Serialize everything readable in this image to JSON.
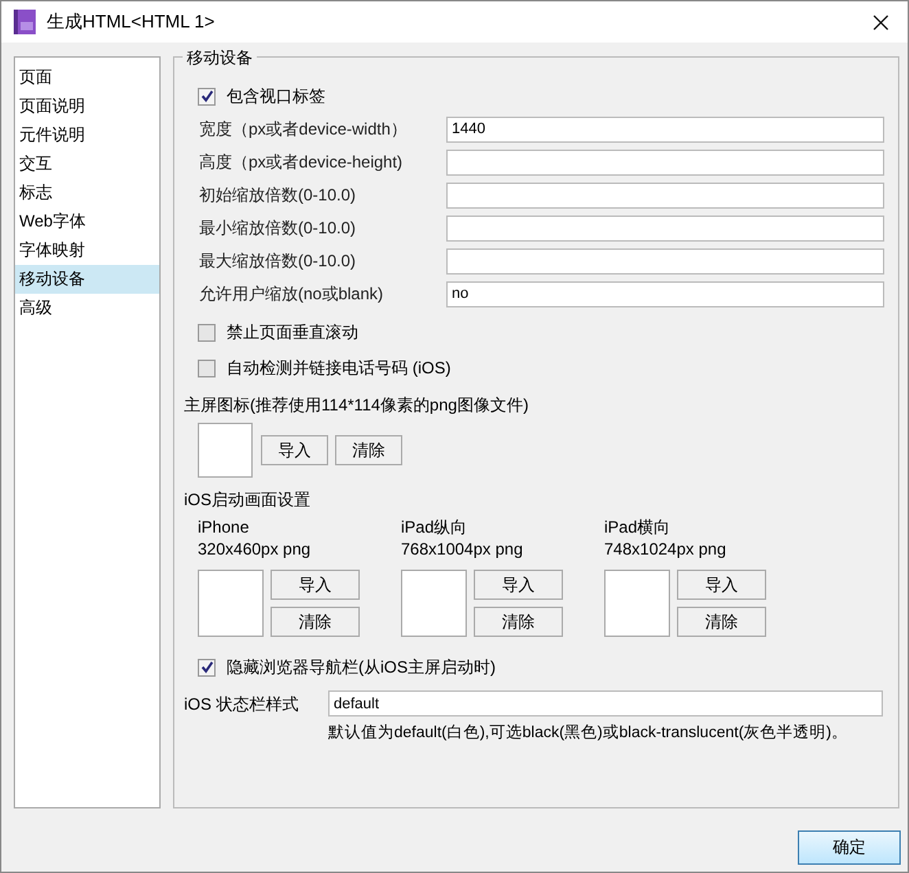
{
  "window": {
    "title": "生成HTML<HTML 1>"
  },
  "sidebar": {
    "items": [
      {
        "label": "页面",
        "selected": false
      },
      {
        "label": "页面说明",
        "selected": false
      },
      {
        "label": "元件说明",
        "selected": false
      },
      {
        "label": "交互",
        "selected": false
      },
      {
        "label": "标志",
        "selected": false
      },
      {
        "label": "Web字体",
        "selected": false
      },
      {
        "label": "字体映射",
        "selected": false
      },
      {
        "label": "移动设备",
        "selected": true
      },
      {
        "label": "高级",
        "selected": false
      }
    ]
  },
  "section": {
    "title": "移动设备",
    "viewport": {
      "label": "包含视口标签",
      "checked": true
    },
    "fields": [
      {
        "label": "宽度（px或者device-width）",
        "value": "1440"
      },
      {
        "label": "高度（px或者device-height)"
      },
      {
        "label": "初始缩放倍数(0-10.0)"
      },
      {
        "label": "最小缩放倍数(0-10.0)"
      },
      {
        "label": "最大缩放倍数(0-10.0)"
      },
      {
        "label": "允许用户缩放(no或blank)",
        "value": "no"
      }
    ],
    "options": [
      {
        "label": "禁止页面垂直滚动",
        "checked": false
      },
      {
        "label": "自动检测并链接电话号码 (iOS)",
        "checked": false
      }
    ],
    "home_icon": {
      "label": "主屏图标(推荐使用114*114像素的png图像文件)",
      "buttons": [
        "导入",
        "清除"
      ]
    },
    "splash": {
      "label": "iOS启动画面设置",
      "items": [
        {
          "name": "iPhone",
          "size": "320x460px png",
          "buttons": [
            "导入",
            "清除"
          ]
        },
        {
          "name": "iPad纵向",
          "size": "768x1004px png",
          "buttons": [
            "导入",
            "清除"
          ]
        },
        {
          "name": "iPad横向",
          "size": "748x1024px png",
          "buttons": [
            "导入",
            "清除"
          ]
        }
      ]
    },
    "hide_nav": {
      "label": "隐藏浏览器导航栏(从iOS主屏启动时)",
      "checked": true
    },
    "status_bar": {
      "label": "iOS 状态栏样式",
      "value": "default",
      "hint": "默认值为default(白色),可选black(黑色)或black-translucent(灰色半透明)。"
    }
  },
  "buttons": [
    "确定"
  ]
}
